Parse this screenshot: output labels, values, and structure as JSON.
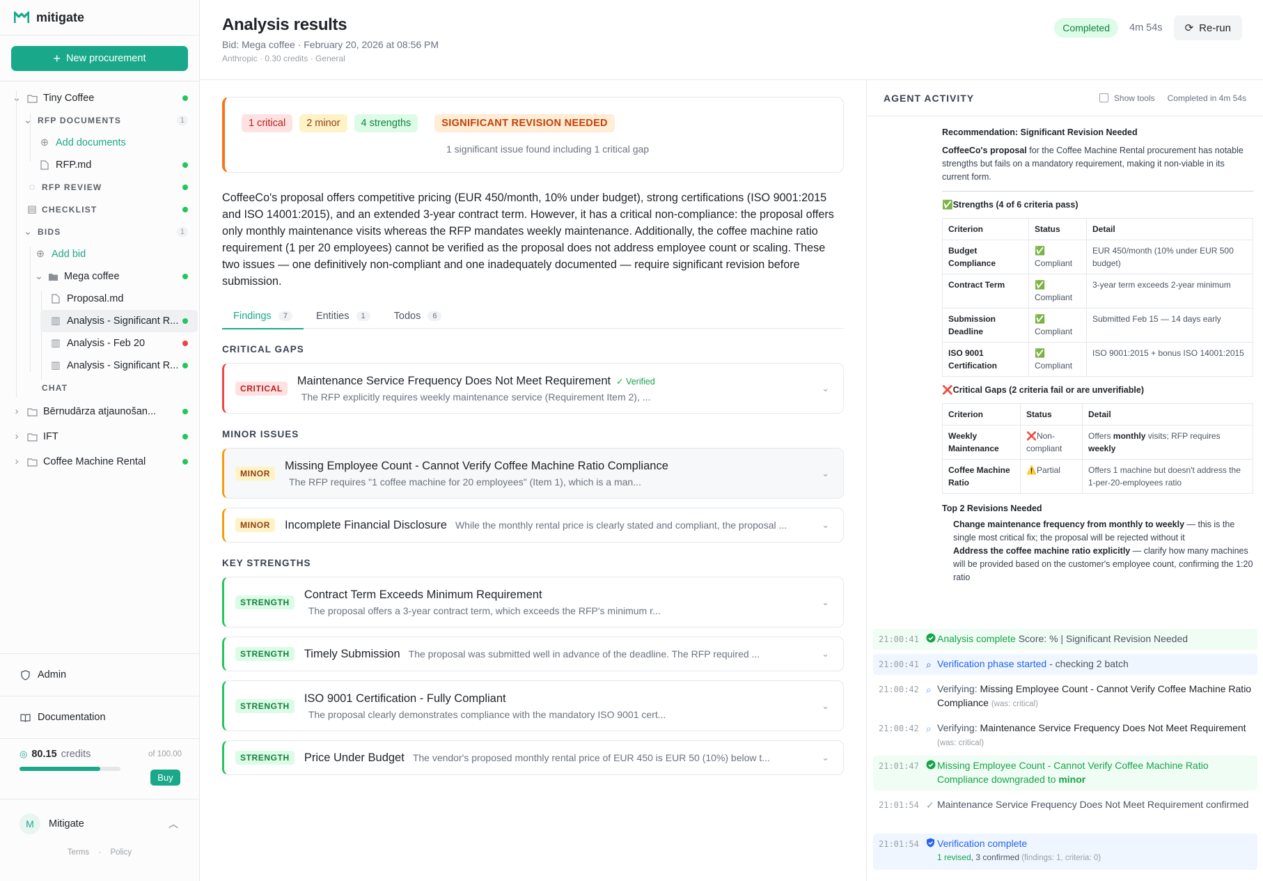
{
  "brand": {
    "name": "mitigate"
  },
  "sidebar": {
    "new_button": "New procurement",
    "projects": [
      {
        "name": "Tiny Coffee"
      },
      {
        "name": "Bērnudārza atjaunošan..."
      },
      {
        "name": "IFT"
      },
      {
        "name": "Coffee Machine Rental"
      }
    ],
    "rfp_documents": {
      "label": "RFP DOCUMENTS",
      "count": "1",
      "add": "Add documents",
      "file": "RFP.md"
    },
    "rfp_review": "RFP REVIEW",
    "checklist": "CHECKLIST",
    "bids": {
      "label": "BIDS",
      "count": "1",
      "add": "Add bid",
      "bid": "Mega coffee",
      "file": "Proposal.md",
      "analyses": [
        "Analysis - Significant R...",
        "Analysis - Feb 20",
        "Analysis - Significant R..."
      ]
    },
    "chat": "CHAT",
    "admin": "Admin",
    "documentation": "Documentation",
    "credits": {
      "value": "80.15",
      "label": "credits",
      "of": "of 100.00",
      "buy": "Buy",
      "fraction": 0.8015
    },
    "user": {
      "initial": "M",
      "name": "Mitigate"
    },
    "footer": {
      "terms": "Terms",
      "sep": "·",
      "policy": "Policy"
    }
  },
  "header": {
    "title": "Analysis results",
    "subtitle": "Bid: Mega coffee · February 20, 2026 at 08:56 PM",
    "meta": "Anthropic  ·  0.30 credits  ·  General",
    "status": "Completed",
    "duration": "4m 54s",
    "rerun": "Re-run"
  },
  "summary": {
    "critical": "1 critical",
    "minor": "2 minor",
    "strengths": "4 strengths",
    "verdict": "SIGNIFICANT REVISION NEEDED",
    "line": "1 significant issue found including 1 critical gap",
    "paragraph": "CoffeeCo's proposal offers competitive pricing (EUR 450/month, 10% under budget), strong certifications (ISO 9001:2015 and ISO 14001:2015), and an extended 3-year contract term. However, it has a critical non-compliance: the proposal offers only monthly maintenance visits whereas the RFP mandates weekly maintenance. Additionally, the coffee machine ratio requirement (1 per 20 employees) cannot be verified as the proposal does not address employee count or scaling. These two issues — one definitively non-compliant and one inadequately documented — require significant revision before submission."
  },
  "tabs": [
    {
      "label": "Findings",
      "count": "7"
    },
    {
      "label": "Entities",
      "count": "1"
    },
    {
      "label": "Todos",
      "count": "6"
    }
  ],
  "sections": {
    "critical": "CRITICAL GAPS",
    "minor": "MINOR ISSUES",
    "strengths": "KEY STRENGTHS"
  },
  "findings": {
    "critical": [
      {
        "tag": "CRITICAL",
        "title": "Maintenance Service Frequency Does Not Meet Requirement",
        "verified": "✓ Verified",
        "desc": "The RFP explicitly requires weekly maintenance service (Requirement Item 2), ..."
      }
    ],
    "minor": [
      {
        "tag": "MINOR",
        "title": "Missing Employee Count - Cannot Verify Coffee Machine Ratio Compliance",
        "desc": "The RFP requires \"1 coffee machine for 20 employees\" (Item 1), which is a man..."
      },
      {
        "tag": "MINOR",
        "title": "Incomplete Financial Disclosure",
        "desc": "While the monthly rental price is clearly stated and compliant, the proposal ..."
      }
    ],
    "strengths": [
      {
        "tag": "STRENGTH",
        "title": "Contract Term Exceeds Minimum Requirement",
        "desc": "The proposal offers a 3-year contract term, which exceeds the RFP's minimum r..."
      },
      {
        "tag": "STRENGTH",
        "title": "Timely Submission",
        "desc": "The proposal was submitted well in advance of the deadline. The RFP required ..."
      },
      {
        "tag": "STRENGTH",
        "title": "ISO 9001 Certification - Fully Compliant",
        "desc": "The proposal clearly demonstrates compliance with the mandatory ISO 9001 cert..."
      },
      {
        "tag": "STRENGTH",
        "title": "Price Under Budget",
        "desc": "The vendor's proposed monthly rental price of EUR 450 is EUR 50 (10%) below t..."
      }
    ]
  },
  "agent": {
    "title": "AGENT ACTIVITY",
    "show_tools": "Show tools",
    "completed": "Completed in 4m 54s",
    "report": {
      "rec_label": "Recommendation:",
      "rec_value": "Significant Revision Needed",
      "intro_bold": "CoffeeCo's proposal",
      "intro_rest": " for the Coffee Machine Rental procurement has notable strengths but fails on a mandatory requirement, making it non-viable in its current form.",
      "strengths_head": "Strengths (4 of 6 criteria pass)",
      "cols": [
        "Criterion",
        "Status",
        "Detail"
      ],
      "strength_rows": [
        {
          "c": "Budget Compliance",
          "s": "Compliant",
          "d": "EUR 450/month (10% under EUR 500 budget)"
        },
        {
          "c": "Contract Term",
          "s": "Compliant",
          "d": "3-year term exceeds 2-year minimum"
        },
        {
          "c": "Submission Deadline",
          "s": "Compliant",
          "d": "Submitted Feb 15 — 14 days early"
        },
        {
          "c": "ISO 9001 Certification",
          "s": "Compliant",
          "d": "ISO 9001:2015 + bonus ISO 14001:2015"
        }
      ],
      "gaps_head": "Critical Gaps (2 criteria fail or are unverifiable)",
      "gap_rows": [
        {
          "c": "Weekly Maintenance",
          "s": "Non-compliant",
          "d1": "Offers ",
          "d1b": "monthly",
          "d2": " visits; RFP requires ",
          "d2b": "weekly"
        },
        {
          "c": "Coffee Machine Ratio",
          "s": "Partial",
          "d": "Offers 1 machine but doesn't address the 1-per-20-employees ratio"
        }
      ],
      "top_head": "Top 2 Revisions Needed",
      "rev1_b": "Change maintenance frequency from monthly to weekly",
      "rev1": " — this is the single most critical fix; the proposal will be rejected without it",
      "rev2_b": "Address the coffee machine ratio explicitly",
      "rev2": " — clarify how many machines will be provided based on the customer's employee count, confirming the 1:20 ratio"
    },
    "events": [
      {
        "ts": "21:00:41",
        "a": "Analysis complete",
        "b": " Score: % | Significant Revision Needed"
      },
      {
        "ts": "21:00:41",
        "a": "Verification phase started",
        "b": " - checking 2 batch"
      },
      {
        "ts": "21:00:42",
        "a": "Verifying: ",
        "b": "Missing Employee Count - Cannot Verify Coffee Machine Ratio Compliance",
        "c": "(was: critical)"
      },
      {
        "ts": "21:00:42",
        "a": "Verifying: ",
        "b": "Maintenance Service Frequency Does Not Meet Requirement",
        "c": "(was: critical)"
      },
      {
        "ts": "21:01:47",
        "a": "Missing Employee Count - Cannot Verify Coffee Machine Ratio Compliance",
        "b": " downgraded to ",
        "c": "minor"
      },
      {
        "ts": "21:01:54",
        "a": "Maintenance Service Frequency Does Not Meet Requirement confirmed"
      },
      {
        "ts": "21:01:54",
        "a": "Verification complete",
        "b": "1 revised",
        "c": ", 3 confirmed",
        "d": " (findings: 1, criteria: 0)"
      }
    ]
  }
}
